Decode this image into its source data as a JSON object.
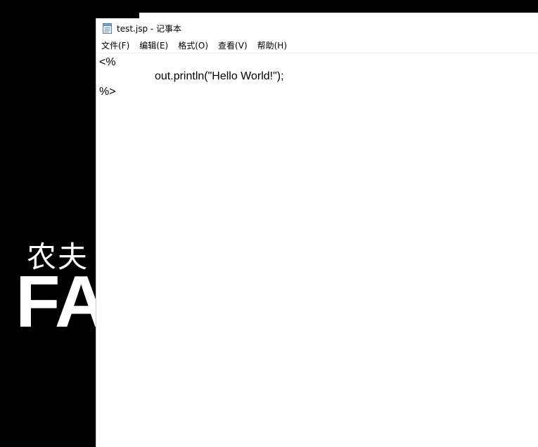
{
  "window": {
    "title": "test.jsp - 记事本"
  },
  "menu": {
    "items": [
      "文件(F)",
      "编辑(E)",
      "格式(O)",
      "查看(V)",
      "帮助(H)"
    ]
  },
  "editor": {
    "lines": [
      "<%",
      "out.println(\"Hello World!\");",
      "%>"
    ]
  },
  "wallpaper": {
    "chinese_text": "农夫",
    "english_text": "FA"
  },
  "colors": {
    "desktop_background": "#000000",
    "window_background": "#ffffff",
    "text": "#000000"
  },
  "icons": {
    "app_icon": "notepad-icon"
  }
}
